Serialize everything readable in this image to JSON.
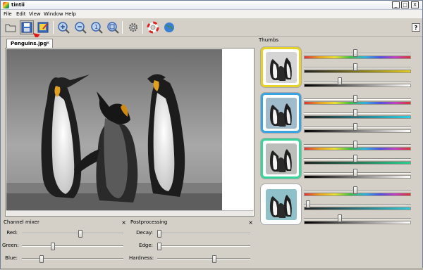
{
  "window": {
    "title": "tintii",
    "minimize": "_",
    "maximize": "□",
    "close": "X"
  },
  "menu": [
    "File",
    "Edit",
    "View",
    "Window",
    "Help"
  ],
  "toolbar": {
    "buttons": [
      "open-icon",
      "save-icon",
      "export-icon",
      "zoom-in-icon",
      "zoom-out-icon",
      "zoom-actual-icon",
      "zoom-fit-icon",
      "settings-icon",
      "help-lifebuoy-icon",
      "web-icon"
    ],
    "help": "?"
  },
  "document": {
    "tab_label": "Penguins.jpg",
    "tab_close": "×"
  },
  "thumbs": {
    "title": "Thumbs",
    "close": "×",
    "items": [
      {
        "frame_color": "#e6d22a",
        "tint": "#ffffff",
        "sliders": [
          0.48,
          0.48,
          0.33
        ],
        "grad2": "#e0cc20"
      },
      {
        "frame_color": "#3aa3e0",
        "tint": "#6ab8e8",
        "sliders": [
          0.48,
          0.48,
          0.48
        ],
        "grad2": "#28d0e8"
      },
      {
        "frame_color": "#3ad49a",
        "tint": "#b9c0b8",
        "sliders": [
          0.48,
          0.48,
          0.48
        ],
        "grad2": "#28d090"
      },
      {
        "frame_color": "#ffffff",
        "tint": "#40c8e0",
        "sliders": [
          0.48,
          0.02,
          0.33
        ],
        "grad2": "#30c8d8"
      }
    ]
  },
  "channel_mixer": {
    "title": "Channel mixer",
    "close": "×",
    "rows": [
      {
        "label": "Red:",
        "value": 0.58
      },
      {
        "label": "Green:",
        "value": 0.3
      },
      {
        "label": "Blue:",
        "value": 0.18
      }
    ]
  },
  "postprocessing": {
    "title": "Postprocessing",
    "close": "×",
    "rows": [
      {
        "label": "Decay:",
        "value": 0.0
      },
      {
        "label": "Edge:",
        "value": 0.0
      },
      {
        "label": "Hardness:",
        "value": 0.62
      }
    ]
  },
  "annotation_arrow_color": "#e01818"
}
